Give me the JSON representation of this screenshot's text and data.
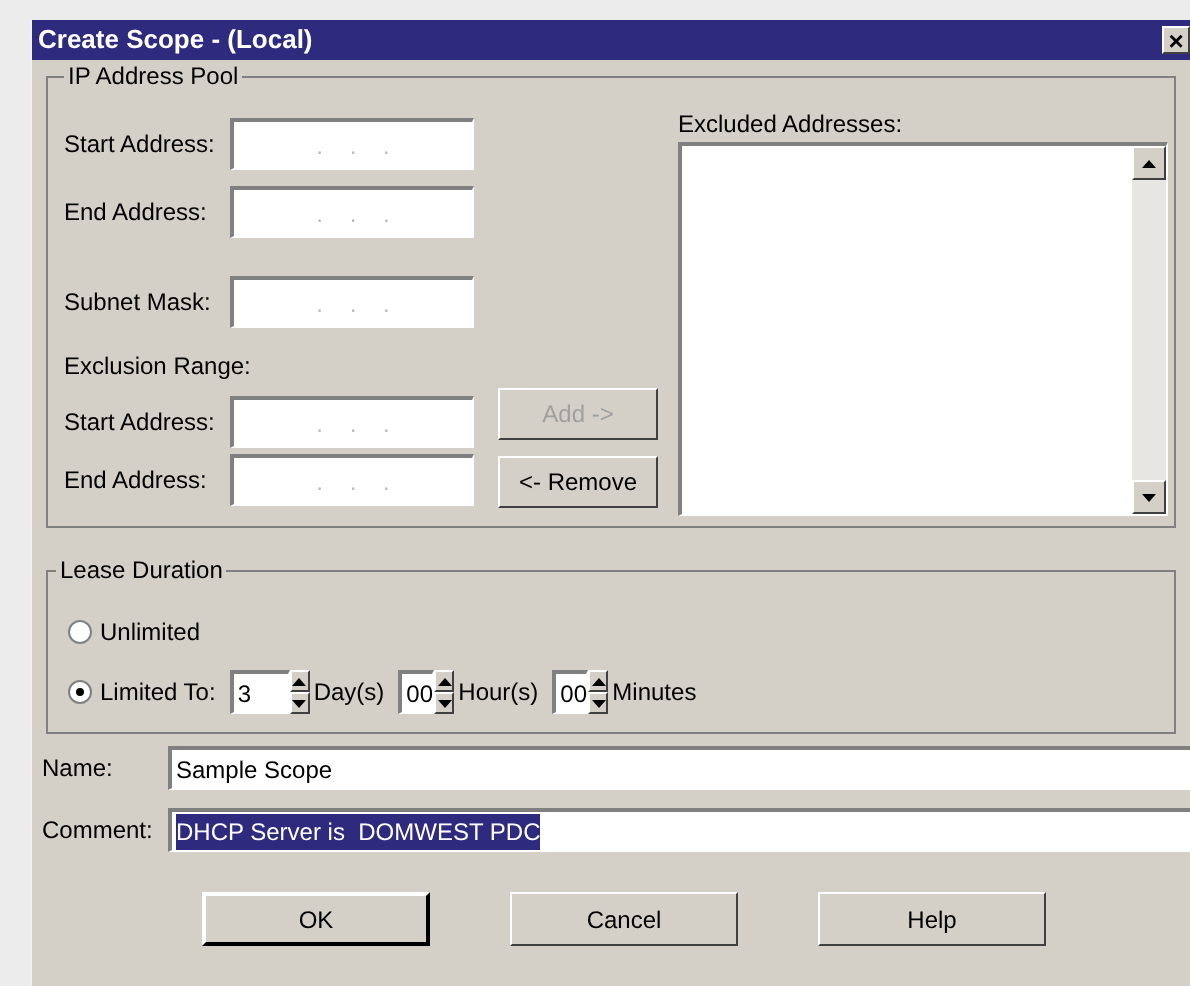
{
  "window": {
    "title": "Create Scope - (Local)",
    "close": "×"
  },
  "pool": {
    "title": "IP Address Pool",
    "fields": [
      {
        "label": "Start Address:",
        "value": ".    .    ."
      },
      {
        "label": "End Address:",
        "value": ".    .    ."
      },
      {
        "label": "Subnet Mask:",
        "value": ".    .    ."
      }
    ],
    "exclusion_label": "Exclusion Range:",
    "exclusion_fields": [
      {
        "label": "Start Address:",
        "value": ".    .    ."
      },
      {
        "label": "End Address:",
        "value": ".    .    ."
      }
    ],
    "buttons": [
      {
        "label": "Add ->",
        "disabled": true
      },
      {
        "label": "<- Remove",
        "disabled": false
      }
    ],
    "excluded_label": "Excluded Addresses:"
  },
  "lease": {
    "title": "Lease Duration",
    "options": [
      {
        "label": "Unlimited",
        "selected": false
      },
      {
        "label": "Limited To:",
        "selected": true
      }
    ],
    "spins": [
      {
        "value": "3",
        "unit": "Day(s)"
      },
      {
        "value": "00",
        "unit": "Hour(s)"
      },
      {
        "value": "00",
        "unit": "Minutes"
      }
    ]
  },
  "name": {
    "label": "Name:",
    "value": "Sample Scope",
    "selected": false
  },
  "comment": {
    "label": "Comment:",
    "value": "DHCP Server is  DOMWEST PDC",
    "selected": true
  },
  "buttons": [
    "OK",
    "Cancel",
    "Help"
  ]
}
